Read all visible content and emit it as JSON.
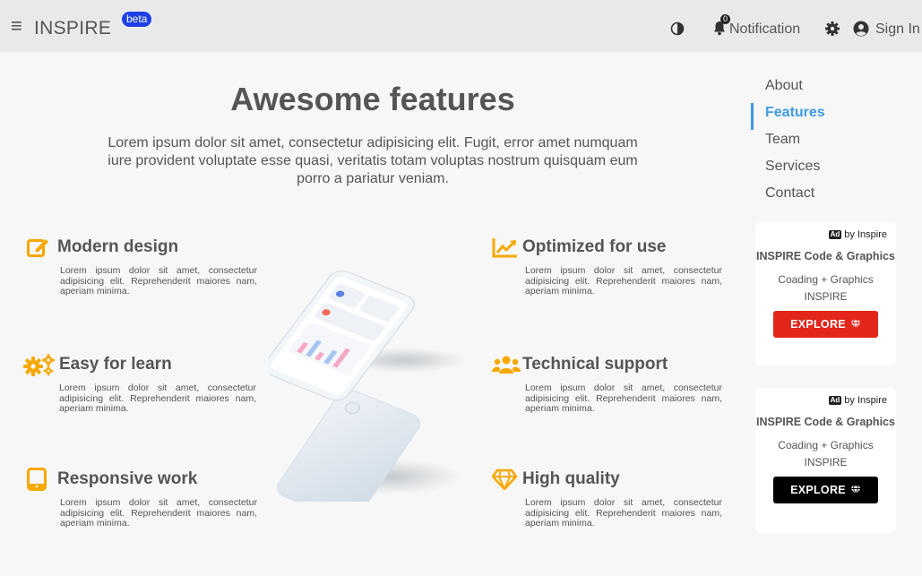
{
  "header": {
    "brand": "INSPIRE",
    "beta_badge": "beta",
    "notification_count": "0",
    "notification_label": "Notification",
    "signin_label": "Sign In"
  },
  "main": {
    "title": "Awesome features",
    "intro": "Lorem ipsum dolor sit amet, consectetur adipisicing elit. Fugit, error amet numquam iure provident voluptate esse quasi, veritatis totam voluptas nostrum quisquam eum porro a pariatur veniam.",
    "features": [
      {
        "title": "Modern design",
        "text": "Lorem ipsum dolor sit amet, consectetur adipisicing elit. Reprehenderit maiores nam, aperiam minima.",
        "icon": "pencil-square-icon"
      },
      {
        "title": "Easy for learn",
        "text": "Lorem ipsum dolor sit amet, consectetur adipisicing elit. Reprehenderit maiores nam, aperiam minima.",
        "icon": "gears-icon"
      },
      {
        "title": "Responsive work",
        "text": "Lorem ipsum dolor sit amet, consectetur adipisicing elit. Reprehenderit maiores nam, aperiam minima.",
        "icon": "tablet-icon"
      },
      {
        "title": "Optimized for use",
        "text": "Lorem ipsum dolor sit amet, consectetur adipisicing elit. Reprehenderit maiores nam, aperiam minima.",
        "icon": "chart-line-icon"
      },
      {
        "title": "Technical support",
        "text": "Lorem ipsum dolor sit amet, consectetur adipisicing elit. Reprehenderit maiores nam, aperiam minima.",
        "icon": "users-icon"
      },
      {
        "title": "High quality",
        "text": "Lorem ipsum dolor sit amet, consectetur adipisicing elit. Reprehenderit maiores nam, aperiam minima.",
        "icon": "diamond-icon"
      }
    ]
  },
  "sidebar": {
    "nav": [
      "About",
      "Features",
      "Team",
      "Services",
      "Contact"
    ],
    "active": "Features"
  },
  "ads": [
    {
      "tag_box": "Ad",
      "tag": "by Inspire",
      "title": "INSPIRE Code & Graphics",
      "subtitle": "Coading + Graphics INSPIRE",
      "button": "EXPLORE",
      "button_color": "#e2261a"
    },
    {
      "tag_box": "Ad",
      "tag": "by Inspire",
      "title": "INSPIRE Code & Graphics",
      "subtitle": "Coading + Graphics INSPIRE",
      "button": "EXPLORE",
      "button_color": "#000000"
    }
  ],
  "colors": {
    "accent_orange": "#f7a800",
    "active_nav": "#3d9be3",
    "beta_badge": "#1e3fe6"
  }
}
